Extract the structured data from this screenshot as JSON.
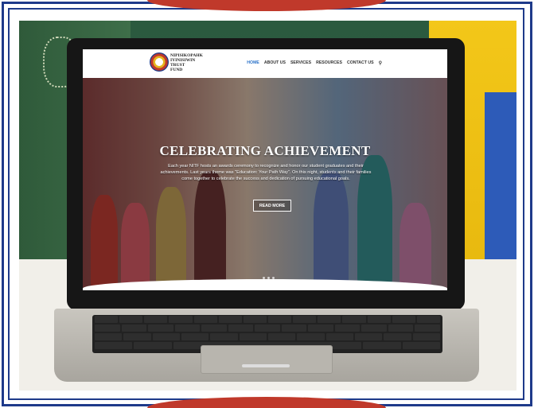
{
  "site": {
    "logo_text": [
      "NIPISIKOPAHK",
      "IYINISIWIN",
      "TRUST",
      "FUND"
    ],
    "nav": {
      "items": [
        {
          "label": "HOME",
          "active": true
        },
        {
          "label": "ABOUT US",
          "active": false
        },
        {
          "label": "SERVICES",
          "active": false
        },
        {
          "label": "RESOURCES",
          "active": false
        },
        {
          "label": "CONTACT US",
          "active": false
        }
      ],
      "search_icon": "search-icon"
    },
    "hero": {
      "title": "CELEBRATING ACHIEVEMENT",
      "text": "Each year NITF hosts an awards ceremony to recognize and honor our student graduates and their achievements. Last years theme was \"Education: Your Path Way\". On this night, students and their families come together to celebrate the success and dedication of pursuing educational goals.",
      "button_label": "READ MORE",
      "slide_dots": 3
    }
  },
  "colors": {
    "frame_blue": "#1e3a8a",
    "frame_red": "#c0392b",
    "nav_active": "#2a72c9"
  }
}
